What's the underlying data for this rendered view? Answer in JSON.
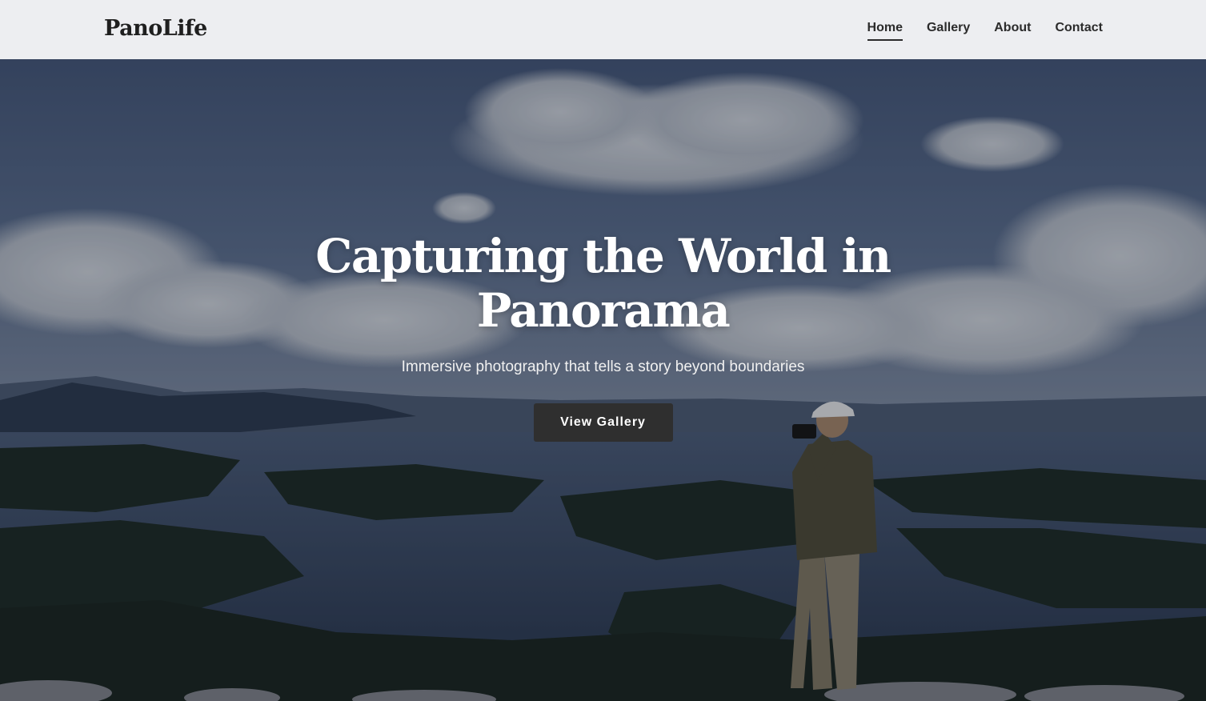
{
  "brand": {
    "name": "PanoLife"
  },
  "nav": {
    "items": [
      {
        "label": "Home",
        "active": true
      },
      {
        "label": "Gallery",
        "active": false
      },
      {
        "label": "About",
        "active": false
      },
      {
        "label": "Contact",
        "active": false
      }
    ]
  },
  "hero": {
    "title": "Capturing the World in Panorama",
    "subtitle": "Immersive photography that tells a story beyond boundaries",
    "cta_label": "View Gallery",
    "background_image": "panoramic-lake-landscape-with-photographer"
  },
  "colors": {
    "navbar_bg": "#f5f6f8",
    "text_dark": "#1f1f1f",
    "button_bg": "#2f2f2f",
    "hero_text": "#ffffff"
  }
}
